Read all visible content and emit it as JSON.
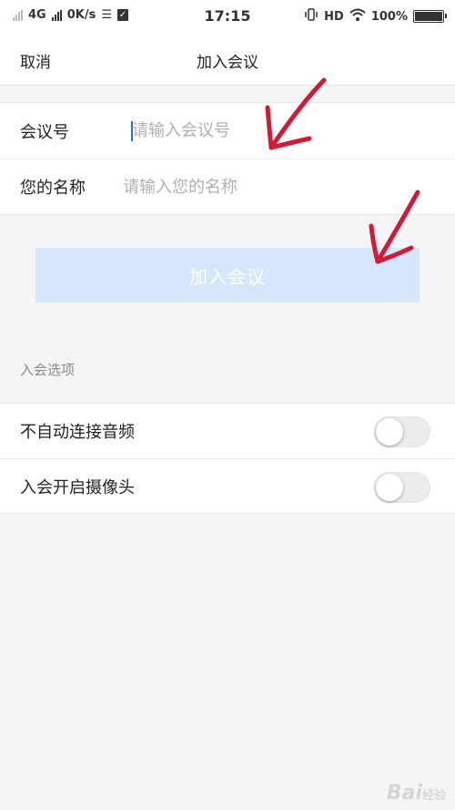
{
  "status_bar": {
    "network": "4G",
    "speed": "0K/s",
    "time": "17:15",
    "hd": "HD",
    "battery": "100%"
  },
  "header": {
    "cancel": "取消",
    "title": "加入会议"
  },
  "form": {
    "meeting_id_label": "会议号",
    "meeting_id_placeholder": "请输入会议号",
    "meeting_id_value": "",
    "name_label": "您的名称",
    "name_placeholder": "请输入您的名称",
    "name_value": ""
  },
  "join_button": "加入会议",
  "options": {
    "section_label": "入会选项",
    "items": [
      {
        "label": "不自动连接音频",
        "enabled": false
      },
      {
        "label": "入会开启摄像头",
        "enabled": false
      }
    ]
  },
  "colors": {
    "join_button_bg": "#d6e7fb",
    "annotation_arrow": "#d11a35",
    "caret": "#2a6fdb"
  },
  "icons": [
    "signal-icon",
    "data-icon",
    "check-icon",
    "vibrate-icon",
    "wifi-icon",
    "battery-icon"
  ],
  "watermark": {
    "logo": "Bai",
    "text": "经验"
  }
}
